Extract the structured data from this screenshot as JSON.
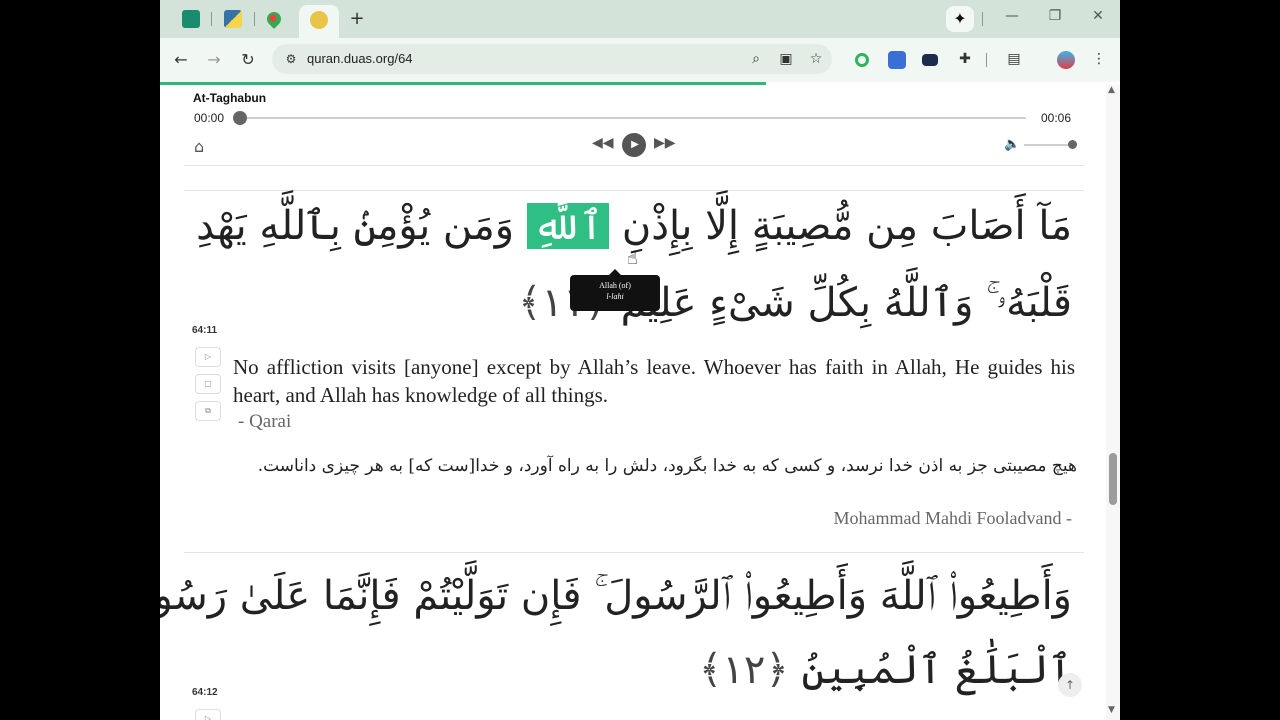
{
  "browser": {
    "tabs": [
      {
        "icon": "duas-icon",
        "color": "#1a8c6e"
      },
      {
        "icon": "python-icon",
        "color": "#3572a5"
      },
      {
        "icon": "maps-icon",
        "color": "#34a853"
      },
      {
        "icon": "quran-icon",
        "color": "#e8c547"
      }
    ],
    "new_tab": "+",
    "url": "quran.duas.org/64",
    "minimize": "—",
    "restore": "❐",
    "close": "✕"
  },
  "player": {
    "title": "At-Taghabun",
    "time_current": "00:00",
    "time_total": "00:06",
    "progress": 0.0,
    "volume": 1.0
  },
  "verses": [
    {
      "number": "64:11",
      "arabic_line1_before": "مَآ أَصَابَ مِن مُّصِيبَةٍ إِلَّا بِإِذْنِ ",
      "arabic_highlight": "ٱللَّهِ",
      "arabic_line1_after": " وَمَن يُؤْمِنۢ بِٱللَّهِ يَهْدِ",
      "arabic_line2": "قَلْبَهُۥ ۚ وَٱللَّهُ بِكُلِّ شَىْءٍ عَلِيمٌ",
      "ayah_marker": "﴿١١﴾",
      "tooltip_meaning": "Allah (of)",
      "tooltip_translit": "l-lahi",
      "english": "No affliction visits [anyone] except by Allah’s leave. Whoever has faith in Allah, He guides his heart, and Allah has knowledge of all things.",
      "english_attr": "- Qarai",
      "farsi": "هيچ مصيبتى جز به اذن خدا نرسد، و كسى كه به خدا بگرود، دلش را به راه آورد، و خدا[ست كه] به هر چيزى داناست.",
      "farsi_attr": "Mohammad Mahdi Fooladvand -"
    },
    {
      "number": "64:12",
      "arabic_line1": "وَأَطِيعُوا۟ ٱللَّهَ وَأَطِيعُوا۟ ٱلرَّسُولَ ۚ فَإِن تَوَلَّيْتُمْ فَإِنَّمَا عَلَىٰ رَسُولِنَا",
      "arabic_line2": "ٱلْبَلَٰغُ ٱلْمُبِينُ",
      "ayah_marker": "﴿١٢﴾"
    }
  ],
  "colors": {
    "highlight": "#2fbf85",
    "tabstrip": "#d3e3d9",
    "toolbar": "#f1f7f3",
    "loading": "#32b57c"
  }
}
